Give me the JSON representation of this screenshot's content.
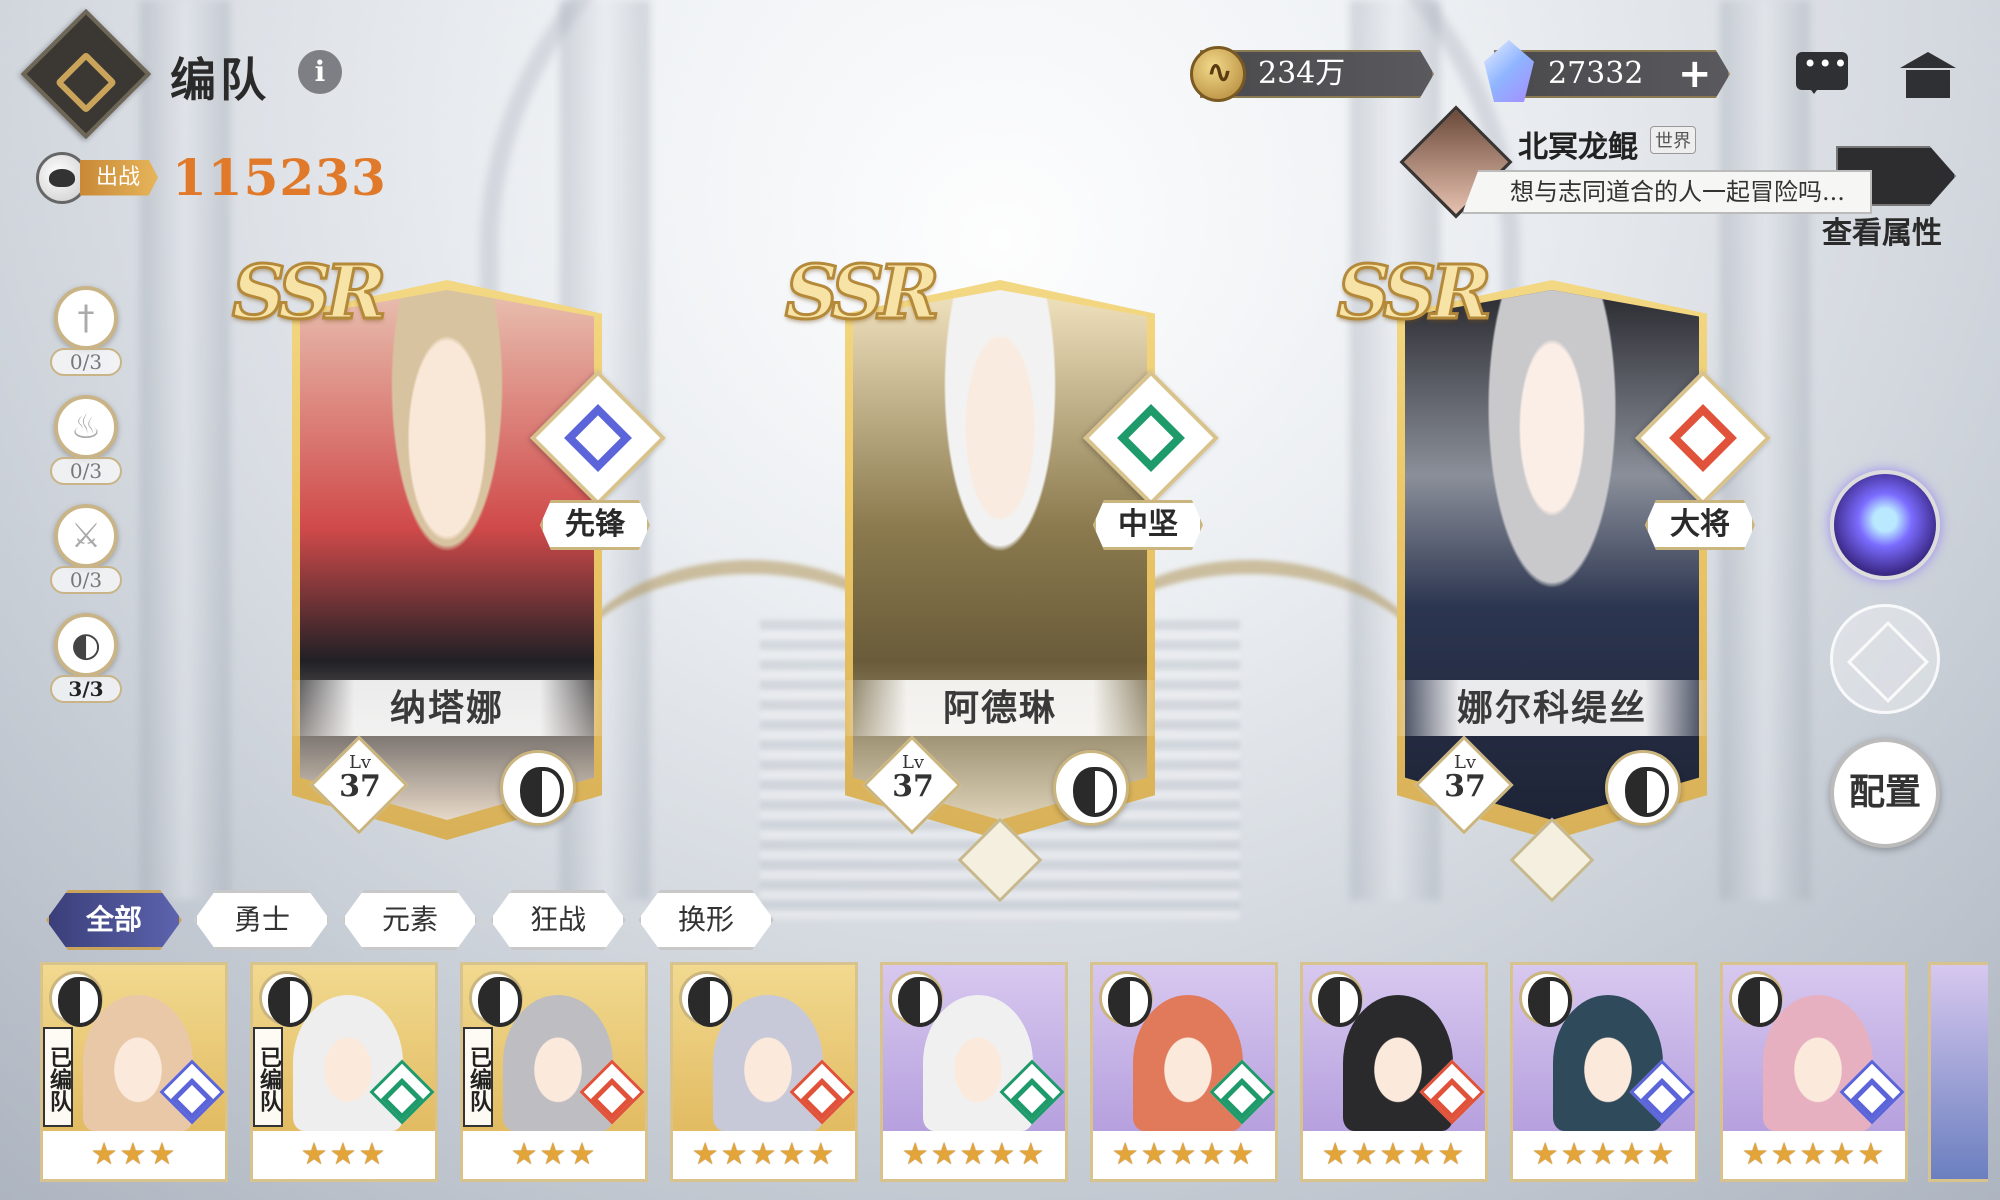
{
  "header": {
    "title": "编队",
    "power_label": "出战",
    "power_value": "115233"
  },
  "currency": {
    "gold": "234万",
    "gems": "27332",
    "plus": "+"
  },
  "chat": {
    "player_name": "北冥龙鲲",
    "channel": "世界",
    "message": "想与志同道合的人一起冒险吗..."
  },
  "view_attributes_label": "查看属性",
  "class_filters": [
    {
      "icon": "sword-class-icon",
      "count": "0/3",
      "glyph": "†"
    },
    {
      "icon": "fire-class-icon",
      "count": "0/3",
      "glyph": "♨"
    },
    {
      "icon": "axe-class-icon",
      "count": "0/3",
      "glyph": "⚔"
    },
    {
      "icon": "mask-class-icon",
      "count": "3/3",
      "glyph": "◐"
    }
  ],
  "heroes": [
    {
      "rarity": "SSR",
      "name": "纳塔娜",
      "role": "先锋",
      "lv_label": "Lv",
      "level": "37",
      "role_color": "#5b64d8"
    },
    {
      "rarity": "SSR",
      "name": "阿德琳",
      "role": "中坚",
      "lv_label": "Lv",
      "level": "37",
      "role_color": "#1f9a6b"
    },
    {
      "rarity": "SSR",
      "name": "娜尔科缇丝",
      "role": "大将",
      "lv_label": "Lv",
      "level": "37",
      "role_color": "#e0523a"
    }
  ],
  "config_label": "配置",
  "tabs": [
    "全部",
    "勇士",
    "元素",
    "狂战",
    "换形"
  ],
  "in_team_label": "已编队",
  "roster": [
    {
      "stars": "★★★",
      "in_team": true,
      "class_icon": "mask-icon",
      "role": "blue",
      "bg": "gold",
      "face": "#e9c8a8"
    },
    {
      "stars": "★★★",
      "in_team": true,
      "class_icon": "mask-icon",
      "role": "green",
      "bg": "gold",
      "face": "#eeeeee"
    },
    {
      "stars": "★★★",
      "in_team": true,
      "class_icon": "mask-icon",
      "role": "red",
      "bg": "gold",
      "face": "#bdbdc2"
    },
    {
      "stars": "★★★★★",
      "in_team": false,
      "class_icon": "sword-icon",
      "role": "red",
      "bg": "gold",
      "face": "#c8c9d8"
    },
    {
      "stars": "★★★★★",
      "in_team": false,
      "class_icon": "mask-icon",
      "role": "green",
      "bg": "purple",
      "face": "#f0f0f0"
    },
    {
      "stars": "★★★★★",
      "in_team": false,
      "class_icon": "sword-icon",
      "role": "green",
      "bg": "purple",
      "face": "#e07a5a"
    },
    {
      "stars": "★★★★★",
      "in_team": false,
      "class_icon": "axe-icon",
      "role": "red",
      "bg": "purple",
      "face": "#2a2a2c"
    },
    {
      "stars": "★★★★★",
      "in_team": false,
      "class_icon": "mask-icon",
      "role": "blue",
      "bg": "purple",
      "face": "#2f4a5a"
    },
    {
      "stars": "★★★★★",
      "in_team": false,
      "class_icon": "sword-icon",
      "role": "blue",
      "bg": "purple",
      "face": "#e6b0c0"
    }
  ]
}
